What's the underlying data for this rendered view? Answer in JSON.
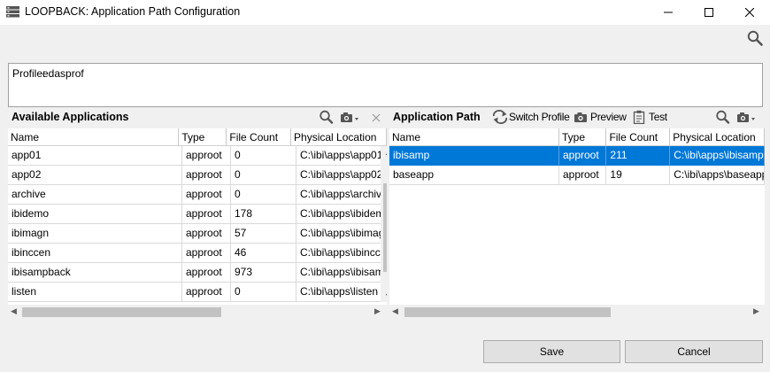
{
  "window": {
    "title": "LOOPBACK: Application Path Configuration",
    "minimize_icon": "minimize-icon",
    "maximize_icon": "maximize-icon",
    "close_icon": "close-icon"
  },
  "profile": {
    "label": "Profile:",
    "value": "edasprof"
  },
  "available": {
    "title": "Available Applications",
    "columns": [
      "Name",
      "Type",
      "File Count",
      "Physical Location"
    ],
    "rows": [
      {
        "name": "app01",
        "type": "approot",
        "count": "0",
        "location": "C:\\ibi\\apps\\app01"
      },
      {
        "name": "app02",
        "type": "approot",
        "count": "0",
        "location": "C:\\ibi\\apps\\app02"
      },
      {
        "name": "archive",
        "type": "approot",
        "count": "0",
        "location": "C:\\ibi\\apps\\archive"
      },
      {
        "name": "ibidemo",
        "type": "approot",
        "count": "178",
        "location": "C:\\ibi\\apps\\ibidemo"
      },
      {
        "name": "ibimagn",
        "type": "approot",
        "count": "57",
        "location": "C:\\ibi\\apps\\ibimagn"
      },
      {
        "name": "ibinccen",
        "type": "approot",
        "count": "46",
        "location": "C:\\ibi\\apps\\ibinccen"
      },
      {
        "name": "ibisampback",
        "type": "approot",
        "count": "973",
        "location": "C:\\ibi\\apps\\ibisampback"
      },
      {
        "name": "listen",
        "type": "approot",
        "count": "0",
        "location": "C:\\ibi\\apps\\listen"
      }
    ]
  },
  "path": {
    "title": "Application Path",
    "switch_profile": "Switch Profile",
    "preview": "Preview",
    "test": "Test",
    "columns": [
      "Name",
      "Type",
      "File Count",
      "Physical Location"
    ],
    "rows": [
      {
        "name": "ibisamp",
        "type": "approot",
        "count": "211",
        "location": "C:\\ibi\\apps\\ibisamp"
      },
      {
        "name": "baseapp",
        "type": "approot",
        "count": "19",
        "location": "C:\\ibi\\apps\\baseapp"
      }
    ]
  },
  "buttons": {
    "save": "Save",
    "cancel": "Cancel"
  },
  "colors": {
    "selection": "#0078d7",
    "background": "#f0f0f0"
  }
}
